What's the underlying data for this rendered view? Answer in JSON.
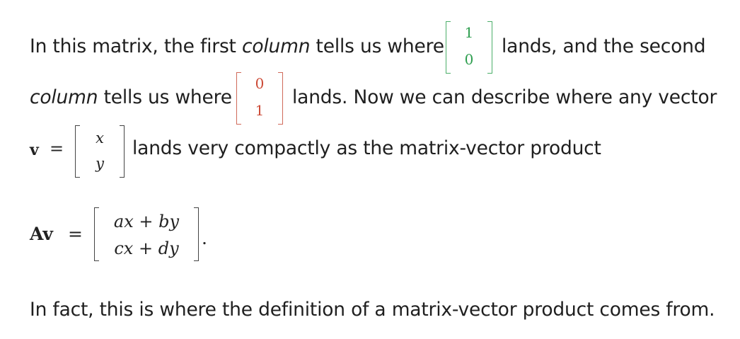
{
  "para1": {
    "line1_a": "In this matrix, the first ",
    "line1_em": "column",
    "line1_b": " tells us where",
    "line1_c": "lands, and the second",
    "line2_em": "column",
    "line2_a": " tells us where",
    "line2_b": "lands. Now we can describe where any vector",
    "line3": "lands very compactly as the matrix-vector product"
  },
  "vec_e1": {
    "top": "1",
    "bottom": "0",
    "color": "#2e9e4f"
  },
  "vec_e2": {
    "top": "0",
    "bottom": "1",
    "color": "#cc4a36"
  },
  "vec_v": {
    "label": "v",
    "equals": "=",
    "top": "x",
    "bottom": "y"
  },
  "product": {
    "label": "Av",
    "equals": "=",
    "row1": "ax + by",
    "row2": "cx + dy",
    "trailing": "."
  },
  "para2": {
    "text": "In fact, this is where the definition of a matrix-vector product comes from."
  }
}
